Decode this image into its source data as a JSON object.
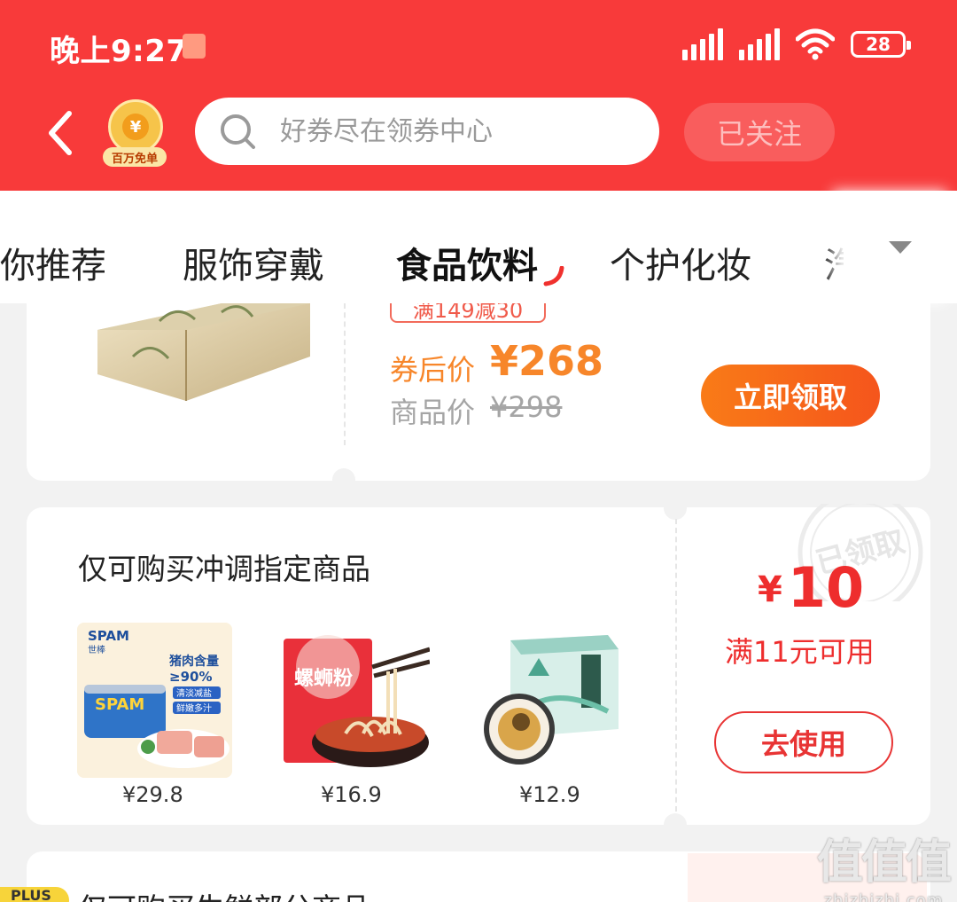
{
  "status": {
    "time": "晚上9:27",
    "battery": "28"
  },
  "header": {
    "badge_label": "百万免单",
    "badge_coin": "¥",
    "search_placeholder": "好券尽在领券中心",
    "follow_label": "已关注"
  },
  "tabs": [
    {
      "label": "为你推荐"
    },
    {
      "label": "服饰穿戴"
    },
    {
      "label": "食品饮料"
    },
    {
      "label": "个护化妆"
    },
    {
      "label": "汽"
    }
  ],
  "active_tab": "食品饮料",
  "card1": {
    "threshold": "满149减30",
    "after_price_label": "券后价",
    "after_price": "¥268",
    "orig_price_label": "商品价",
    "orig_price": "¥298",
    "claim_label": "立即领取"
  },
  "card2": {
    "title": "仅可购买冲调指定商品",
    "stamp_text": "已领取",
    "coupon_currency": "¥",
    "coupon_value": "10",
    "coupon_condition": "满11元可用",
    "use_label": "去使用",
    "products": [
      {
        "price": "¥29.8",
        "brand": "SPAM",
        "brand_sub": "世棒",
        "feature1": "猪肉含量",
        "feature2": "≥90%",
        "tag1": "清淡减盐",
        "tag2": "鲜嫩多汁"
      },
      {
        "price": "¥16.9",
        "name": "螺蛳粉"
      },
      {
        "price": "¥12.9"
      }
    ]
  },
  "card3": {
    "badge": "PLUS",
    "title": "仅可购买生鲜部分商品"
  },
  "watermark": {
    "mark": "值值值",
    "url": "zhizhizhi.com"
  },
  "colors": {
    "header_red": "#f83a3a",
    "accent_orange": "#f7862a",
    "coupon_red": "#ee2d2d"
  }
}
